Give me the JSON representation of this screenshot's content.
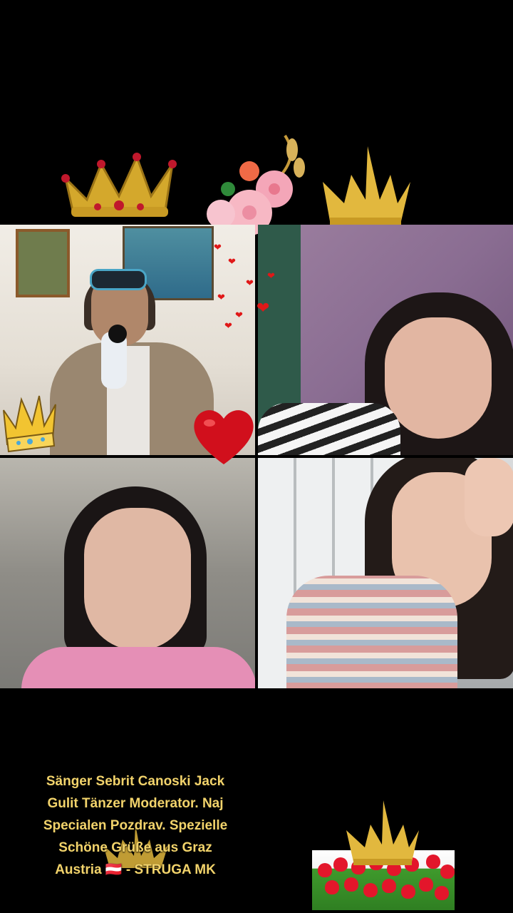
{
  "caption": {
    "text": "Sänger Sebrit Canoski Jack Gulit Tänzer Moderator. Naj Specialen Pozdrav. Spezielle Schöne Grüße aus Graz Austria 🇦🇹 - STRUGA MK"
  },
  "tiles": [
    {
      "id": "tile-1",
      "subject": "man-with-microphone"
    },
    {
      "id": "tile-2",
      "subject": "woman-resting-cheek"
    },
    {
      "id": "tile-3",
      "subject": "woman-pink-jacket"
    },
    {
      "id": "tile-4",
      "subject": "woman-striped-shirt"
    }
  ],
  "decorations": {
    "crown_glyph": "♛",
    "heart_glyph": "❤",
    "flower_glyph": "✿"
  },
  "colors": {
    "background": "#000000",
    "caption": "#f2d36b",
    "gold": "#e0b53a",
    "heart": "#e01818"
  }
}
